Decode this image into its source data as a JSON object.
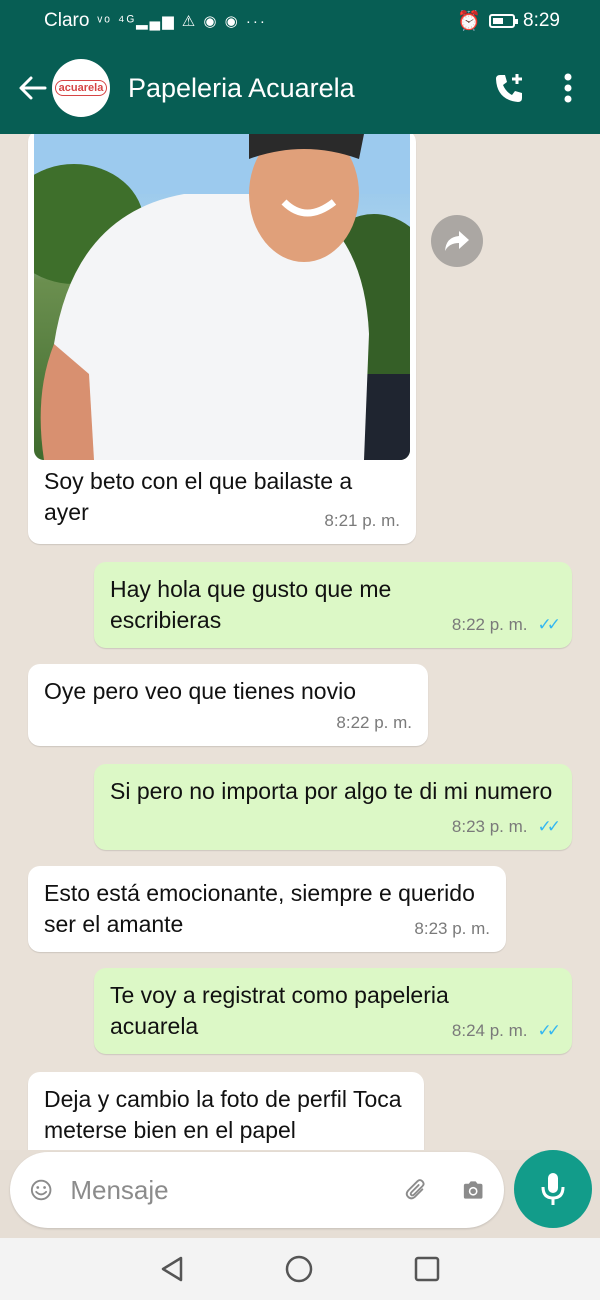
{
  "status_bar": {
    "carrier": "Claro",
    "network": "Vo LTE 4G",
    "time": "8:29"
  },
  "header": {
    "avatar_text": "acuarela",
    "contact_name": "Papeleria Acuarela"
  },
  "messages": [
    {
      "dir": "in",
      "text": "Soy beto con el que bailaste a ayer",
      "time": "8:21 p. m."
    },
    {
      "dir": "out",
      "text": "Hay hola que gusto que me escribieras",
      "time": "8:22 p. m."
    },
    {
      "dir": "in",
      "text": "Oye pero veo que tienes novio",
      "time": "8:22 p. m."
    },
    {
      "dir": "out",
      "text": "Si pero no importa por algo te di mi numero",
      "time": "8:23 p. m."
    },
    {
      "dir": "in",
      "text": "Esto está emocionante, siempre e querido ser el amante",
      "time": "8:23 p. m."
    },
    {
      "dir": "out",
      "text": "Te voy a registrat como papeleria acuarela",
      "time": "8:24 p. m."
    },
    {
      "dir": "in",
      "text": "Deja y cambio la foto de perfil Toca meterse bien en el papel",
      "time": ""
    }
  ],
  "input": {
    "placeholder": "Mensaje"
  },
  "colors": {
    "header": "#075e54",
    "outgoing": "#dcf8c6",
    "incoming": "#ffffff",
    "read_ticks": "#34b7f1",
    "mic": "#129c8a"
  }
}
